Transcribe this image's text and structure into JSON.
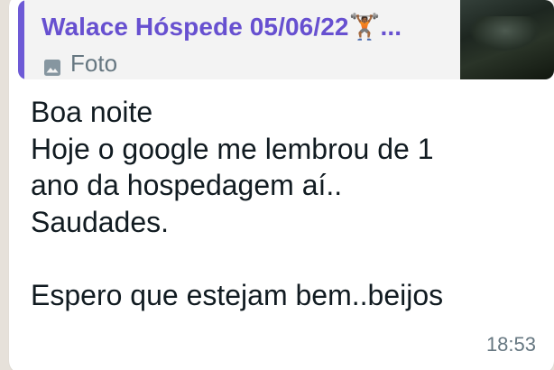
{
  "message": {
    "quoted": {
      "author": "Walace Hóspede 05/06/22🏋🏾...",
      "type_label": "Foto",
      "type_icon": "photo-icon",
      "accent_color": "#6750d0"
    },
    "text": "Boa noite\nHoje o google me lembrou de 1\nano da hospedagem aí..\nSaudades.\n\nEspero que estejam bem..beijos",
    "time": "18:53"
  }
}
